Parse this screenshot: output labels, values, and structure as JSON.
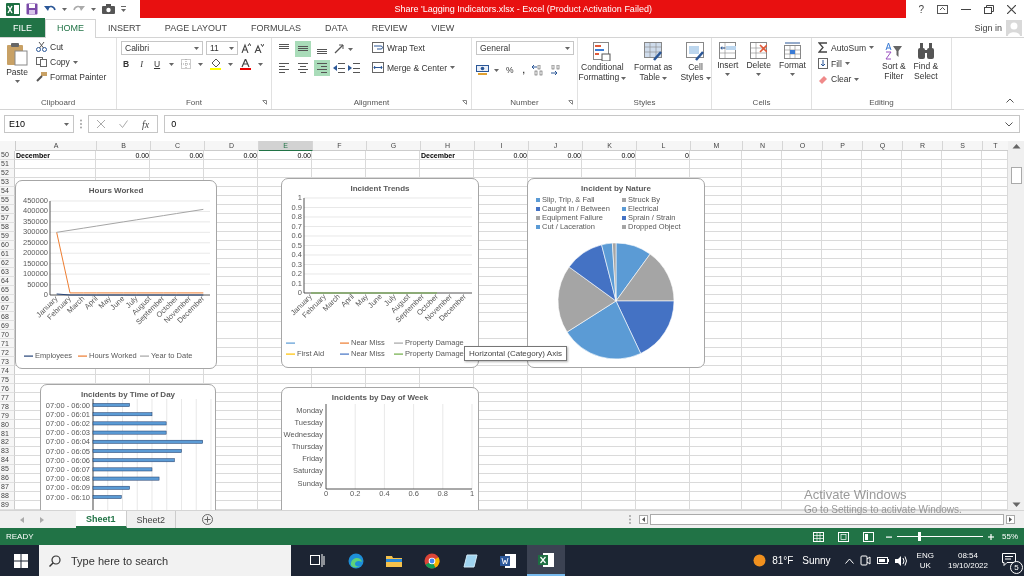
{
  "window": {
    "title": "Share 'Lagging Indicators.xlsx -  Excel (Product Activation Failed)",
    "help": "?"
  },
  "ribbon_tabs": [
    {
      "label": "FILE",
      "kind": "file",
      "selected": false
    },
    {
      "label": "HOME",
      "kind": "tab",
      "selected": true
    },
    {
      "label": "INSERT",
      "kind": "tab",
      "selected": false
    },
    {
      "label": "PAGE LAYOUT",
      "kind": "tab",
      "selected": false
    },
    {
      "label": "FORMULAS",
      "kind": "tab",
      "selected": false
    },
    {
      "label": "DATA",
      "kind": "tab",
      "selected": false
    },
    {
      "label": "REVIEW",
      "kind": "tab",
      "selected": false
    },
    {
      "label": "VIEW",
      "kind": "tab",
      "selected": false
    }
  ],
  "account": {
    "label": "Sign in"
  },
  "clipboard": {
    "paste": "Paste",
    "cut": "Cut",
    "copy": "Copy",
    "format_painter": "Format Painter",
    "group_label": "Clipboard"
  },
  "font": {
    "name": "Calibri",
    "size": "11",
    "bold": "B",
    "italic": "I",
    "underline": "U",
    "group_label": "Font"
  },
  "alignment": {
    "buttons": [
      {
        "kind": "top",
        "selected": false
      },
      {
        "kind": "middle",
        "selected": true
      },
      {
        "kind": "bottom",
        "selected": false
      },
      {
        "kind": "left",
        "selected": false
      },
      {
        "kind": "center",
        "selected": false
      },
      {
        "kind": "right",
        "selected": true
      }
    ],
    "wrap_text": "Wrap Text",
    "merge_center": "Merge & Center",
    "group_label": "Alignment"
  },
  "number": {
    "format": "General",
    "percent": "%",
    "comma": ",",
    "group_label": "Number"
  },
  "styles": {
    "buttons": [
      {
        "kind": "conditional",
        "lines": [
          "Conditional",
          "Formatting"
        ]
      },
      {
        "kind": "table",
        "lines": [
          "Format as",
          "Table"
        ]
      },
      {
        "kind": "cell",
        "lines": [
          "Cell",
          "Styles"
        ]
      }
    ],
    "group_label": "Styles"
  },
  "cells": {
    "buttons": [
      {
        "kind": "insert",
        "label": "Insert"
      },
      {
        "kind": "delete",
        "label": "Delete"
      },
      {
        "kind": "format",
        "label": "Format"
      }
    ],
    "group_label": "Cells"
  },
  "editing": {
    "autosum": "AutoSum",
    "fill": "Fill",
    "clear": "Clear",
    "sort_filter": [
      "Sort &",
      "Filter"
    ],
    "find_select": [
      "Find &",
      "Select"
    ],
    "group_label": "Editing"
  },
  "formula_bar": {
    "name_box": "E10",
    "function_symbol": "fx",
    "value": "0"
  },
  "columns": [
    {
      "label": "A",
      "selected": false,
      "cell": "December",
      "kind": "label"
    },
    {
      "label": "B",
      "selected": false,
      "cell": "0.00",
      "kind": "number"
    },
    {
      "label": "C",
      "selected": false,
      "cell": "0.00",
      "kind": "number"
    },
    {
      "label": "D",
      "selected": false,
      "cell": "0.00",
      "kind": "number"
    },
    {
      "label": "E",
      "selected": true,
      "cell": "0.00",
      "kind": "number"
    },
    {
      "label": "F",
      "selected": false
    },
    {
      "label": "G",
      "selected": false
    },
    {
      "label": "H",
      "selected": false,
      "cell": "December",
      "kind": "label"
    },
    {
      "label": "I",
      "selected": false,
      "cell": "0.00",
      "kind": "number"
    },
    {
      "label": "J",
      "selected": false,
      "cell": "0.00",
      "kind": "number"
    },
    {
      "label": "K",
      "selected": false,
      "cell": "0.00",
      "kind": "number"
    },
    {
      "label": "L",
      "selected": false,
      "cell": "0",
      "kind": "number"
    },
    {
      "label": "M",
      "selected": false
    },
    {
      "label": "N",
      "selected": false
    },
    {
      "label": "O",
      "selected": false
    },
    {
      "label": "P",
      "selected": false
    },
    {
      "label": "Q",
      "selected": false
    },
    {
      "label": "R",
      "selected": false
    },
    {
      "label": "S",
      "selected": false
    },
    {
      "label": "T",
      "selected": false
    }
  ],
  "rows": [
    "50",
    "51",
    "52",
    "53",
    "54",
    "55",
    "56",
    "57",
    "58",
    "59",
    "60",
    "61",
    "62",
    "63",
    "64",
    "65",
    "66",
    "67",
    "68",
    "69",
    "70",
    "71",
    "72",
    "73",
    "74",
    "75",
    "76",
    "77",
    "78",
    "79",
    "80",
    "81",
    "82",
    "83",
    "84",
    "85",
    "86",
    "87",
    "88",
    "89"
  ],
  "charts": {
    "hours_worked": {
      "title": "Hours Worked",
      "chart_data": {
        "type": "line",
        "categories": [
          "January",
          "February",
          "March",
          "April",
          "May",
          "June",
          "July",
          "August",
          "September",
          "October",
          "November",
          "December"
        ],
        "ylim": [
          0,
          450000
        ],
        "yticks": [
          0,
          50000,
          100000,
          150000,
          200000,
          250000,
          300000,
          350000,
          400000,
          450000
        ],
        "grid": true,
        "legend": "bottom",
        "series": [
          {
            "name": "Employees",
            "color": "#264478",
            "values": [
              5000,
              0,
              0,
              0,
              0,
              0,
              0,
              0,
              0,
              0,
              0,
              0
            ]
          },
          {
            "name": "Hours Worked",
            "color": "#ed7d31",
            "values": [
              300000,
              10000,
              10000,
              10000,
              10000,
              10000,
              10000,
              10000,
              10000,
              10000,
              10000,
              10000
            ]
          },
          {
            "name": "Year to Date",
            "color": "#a5a5a5",
            "values": [
              300000,
              310000,
              320000,
              330000,
              340000,
              350000,
              360000,
              370000,
              380000,
              390000,
              400000,
              410000
            ]
          }
        ]
      }
    },
    "incident_trends": {
      "title": "Incident Trends",
      "chart_data": {
        "type": "line",
        "categories": [
          "January",
          "February",
          "March",
          "April",
          "May",
          "June",
          "July",
          "August",
          "September",
          "October",
          "November",
          "December"
        ],
        "ylim": [
          0,
          1
        ],
        "yticks": [
          0,
          0.1,
          0.2,
          0.3,
          0.4,
          0.5,
          0.6,
          0.7,
          0.8,
          0.9,
          1
        ],
        "grid": true,
        "legend": "bottom",
        "series": [
          {
            "color": "#5b9bd5",
            "values": [
              null,
              null,
              null,
              null,
              null,
              null,
              null,
              null,
              null,
              null,
              null,
              null
            ]
          },
          {
            "name": "Near Miss",
            "color": "#ed7d31",
            "values": [
              null,
              null,
              null,
              null,
              null,
              null,
              null,
              null,
              null,
              null,
              null,
              null
            ]
          },
          {
            "name": "Property Damage",
            "color": "#a5a5a5",
            "values": [
              null,
              null,
              null,
              null,
              null,
              null,
              null,
              null,
              null,
              null,
              null,
              null
            ]
          },
          {
            "name": "First Aid",
            "color": "#ffc000",
            "values": [
              null,
              null,
              null,
              null,
              null,
              null,
              null,
              null,
              null,
              null,
              null,
              null
            ]
          },
          {
            "name": "Near Miss",
            "color": "#4472c4",
            "values": [
              null,
              null,
              null,
              null,
              null,
              null,
              null,
              null,
              null,
              null,
              null,
              null
            ]
          },
          {
            "name": "Property Damage",
            "color": "#70ad47",
            "values": [
              0,
              0,
              0,
              0,
              0,
              0,
              0,
              0,
              0,
              0,
              null,
              null
            ]
          }
        ]
      }
    },
    "incident_by_nature": {
      "title": "Incident by Nature",
      "legend": [
        {
          "label": "Slip, Trip, & Fall",
          "color": "#5b9bd5"
        },
        {
          "label": "Struck By",
          "color": "#a5a5a5"
        },
        {
          "label": "Caught In / Between",
          "color": "#4472c4"
        },
        {
          "label": "Electrical",
          "color": "#5b9bd5"
        },
        {
          "label": "Equipment Failure",
          "color": "#a5a5a5"
        },
        {
          "label": "Sprain / Strain",
          "color": "#4472c4"
        },
        {
          "label": "Cut / Laceration",
          "color": "#5b9bd5"
        },
        {
          "label": "Dropped Object",
          "color": "#a5a5a5"
        }
      ]
    },
    "incidents_by_time_of_day": {
      "title": "Incidents by Time of Day",
      "category_labels": [
        "07:00 - 06:00",
        "07:00 - 06:01",
        "07:00 - 06:02",
        "07:00 - 06:03",
        "07:00 - 06:04",
        "07:00 - 06:05",
        "07:00 - 06:06",
        "07:00 - 06:07",
        "07:00 - 06:08",
        "07:00 - 06:09",
        "07:00 - 06:10"
      ]
    },
    "incidents_by_day_of_week": {
      "title": "Incidents by Day of Week",
      "chart_data": {
        "type": "bar",
        "orientation": "horizontal",
        "categories": [
          "Monday",
          "Tuesday",
          "Wednesday",
          "Thursday",
          "Friday",
          "Saturday",
          "Sunday"
        ],
        "values": [
          0,
          0,
          0,
          0,
          0,
          0,
          0
        ],
        "xlim": [
          0,
          1
        ],
        "xticks": [
          0,
          0.2,
          0.4,
          0.6,
          0.8,
          1
        ],
        "grid": true
      }
    }
  },
  "tooltip": "Horizontal (Category) Axis",
  "sheet_tabs": [
    {
      "label": "Sheet1",
      "selected": true
    },
    {
      "label": "Sheet2",
      "selected": false
    }
  ],
  "status_bar": {
    "status": "READY",
    "zoom": "55%",
    "zoom_slider": {
      "level": 0.26
    }
  },
  "activation_notice": {
    "title": "Activate Windows",
    "hint": "Go to Settings to activate Windows."
  },
  "taskbar": {
    "search_placeholder": "Type here to search",
    "apps": [
      {
        "kind": "task-view",
        "active": false
      },
      {
        "kind": "edge",
        "active": false
      },
      {
        "kind": "explorer",
        "active": false
      },
      {
        "kind": "chrome",
        "active": false
      },
      {
        "kind": "notes",
        "active": false
      },
      {
        "kind": "word",
        "active": false
      },
      {
        "kind": "excel",
        "active": true
      }
    ],
    "temperature": "81°F",
    "weather": "Sunny",
    "language": "ENG",
    "region": "UK",
    "time": "08:54",
    "date": "19/10/2022",
    "notifications": "5"
  }
}
